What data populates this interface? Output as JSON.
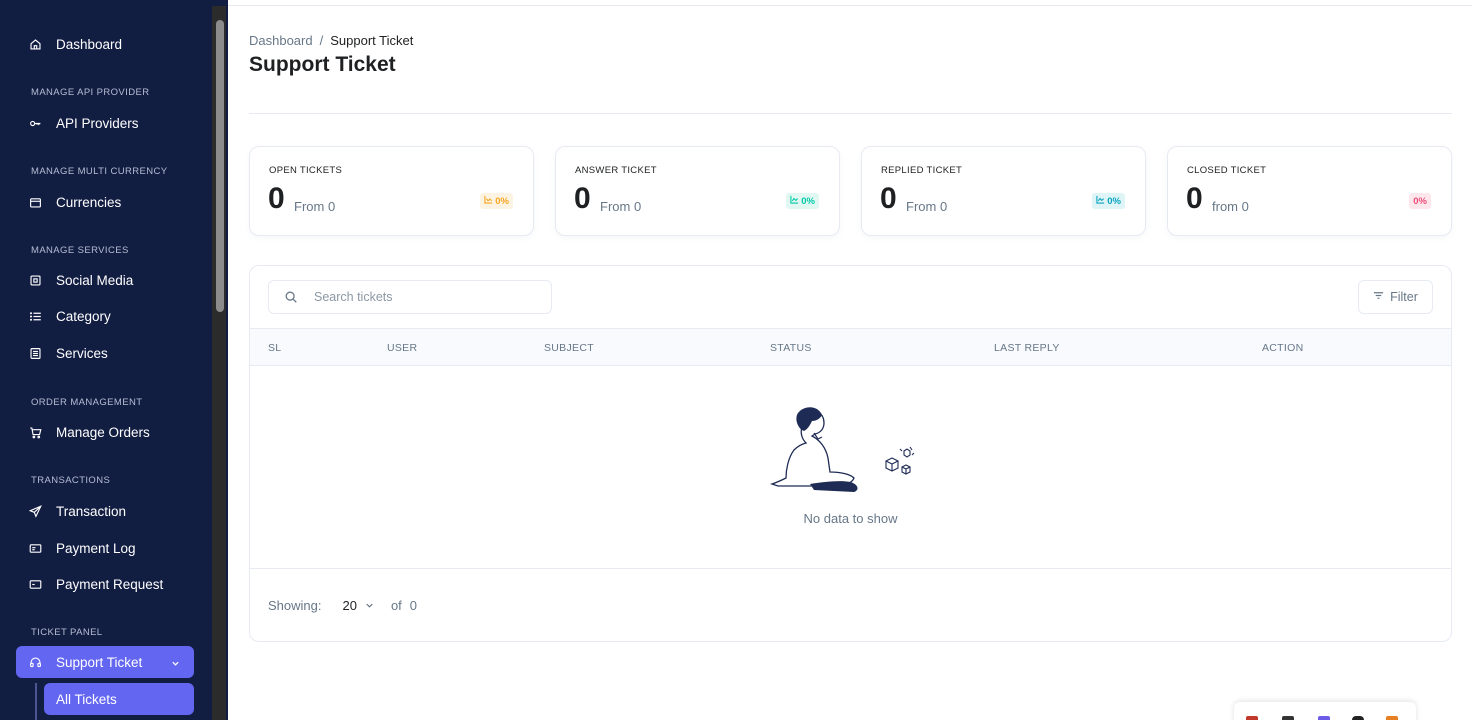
{
  "sidebar": {
    "items": [
      {
        "label": "Dashboard",
        "icon": "home-icon"
      },
      {
        "section": "MANAGE API PROVIDER"
      },
      {
        "label": "API Providers",
        "icon": "key-icon"
      },
      {
        "section": "MANAGE MULTI CURRENCY"
      },
      {
        "label": "Currencies",
        "icon": "wallet-icon"
      },
      {
        "section": "MANAGE SERVICES"
      },
      {
        "label": "Social Media",
        "icon": "square-dot-icon"
      },
      {
        "label": "Category",
        "icon": "list-icon"
      },
      {
        "label": "Services",
        "icon": "document-list-icon"
      },
      {
        "section": "ORDER MANAGEMENT"
      },
      {
        "label": "Manage Orders",
        "icon": "cart-icon"
      },
      {
        "section": "TRANSACTIONS"
      },
      {
        "label": "Transaction",
        "icon": "send-icon"
      },
      {
        "label": "Payment Log",
        "icon": "card-icon"
      },
      {
        "label": "Payment Request",
        "icon": "card-icon"
      },
      {
        "section": "TICKET PANEL"
      },
      {
        "label": "Support Ticket",
        "icon": "headset-icon"
      }
    ],
    "sub_item": "All Tickets"
  },
  "breadcrumb": {
    "parent": "Dashboard",
    "separator": "/",
    "current": "Support Ticket"
  },
  "page_title": "Support Ticket",
  "stats": [
    {
      "label": "OPEN TICKETS",
      "value": "0",
      "from": "From 0",
      "badge": "0%",
      "badge_color": "#f5a623",
      "badge_bg": "#fdf3e2"
    },
    {
      "label": "ANSWER TICKET",
      "value": "0",
      "from": "From 0",
      "badge": "0%",
      "badge_color": "#00c9a7",
      "badge_bg": "#e0f7f2"
    },
    {
      "label": "REPLIED TICKET",
      "value": "0",
      "from": "From 0",
      "badge": "0%",
      "badge_color": "#09a5be",
      "badge_bg": "#dff4f7"
    },
    {
      "label": "CLOSED TICKET",
      "value": "0",
      "from": "from 0",
      "badge": "0%",
      "badge_color": "#ed4c78",
      "badge_bg": "#fde6ec"
    }
  ],
  "search": {
    "placeholder": "Search tickets",
    "value": ""
  },
  "filter_label": "Filter",
  "table": {
    "columns": [
      "SL",
      "USER",
      "SUBJECT",
      "STATUS",
      "LAST REPLY",
      "ACTION"
    ],
    "rows": [],
    "empty_text": "No data to show"
  },
  "pagination": {
    "showing_label": "Showing:",
    "page_size": "20",
    "of_label": "of",
    "total": "0"
  },
  "colors": {
    "sidebar_bg": "#121d42",
    "accent": "#6366f1"
  }
}
